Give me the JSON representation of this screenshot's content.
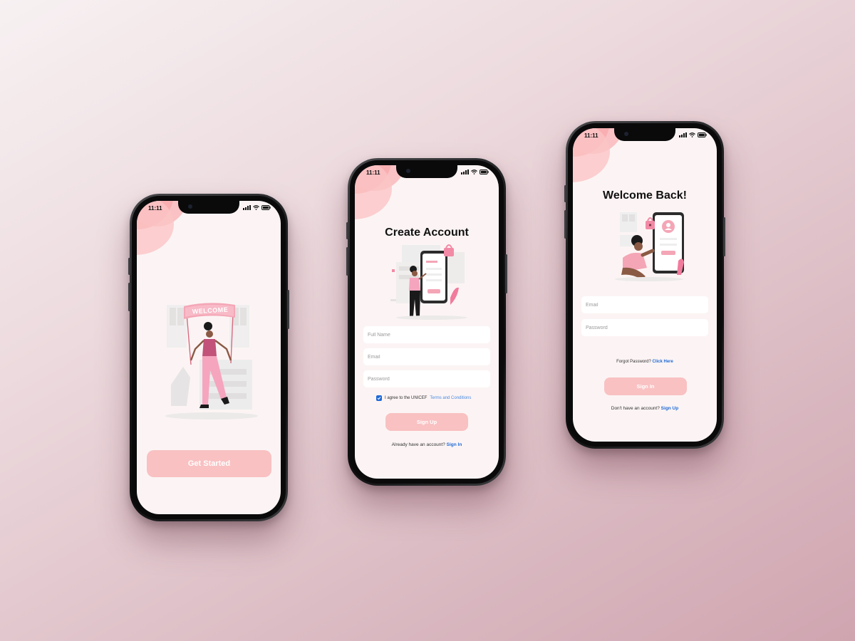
{
  "status": {
    "time": "11:11"
  },
  "welcome_screen": {
    "banner_text": "WELCOME",
    "button_label": "Get Started"
  },
  "signup_screen": {
    "title": "Create Account",
    "full_name_placeholder": "Full Name",
    "email_placeholder": "Email",
    "password_placeholder": "Password",
    "agree_text": "I agree to the UNICEF",
    "terms_link": "Terms and Conditions",
    "button_label": "Sign Up",
    "footer_text": "Already have an account?",
    "footer_link": "Sign In"
  },
  "login_screen": {
    "title": "Welcome Back!",
    "email_placeholder": "Email",
    "password_placeholder": "Password",
    "forgot_text": "Forgot Password?",
    "forgot_link": "Click Here",
    "button_label": "Sign In",
    "footer_text": "Don't have an account?",
    "footer_link": "Sign Up"
  },
  "colors": {
    "accent": "#f9c1c2",
    "blob": "#f69a9e",
    "link": "#1f6ad6",
    "screen_bg": "#fcf4f4"
  }
}
